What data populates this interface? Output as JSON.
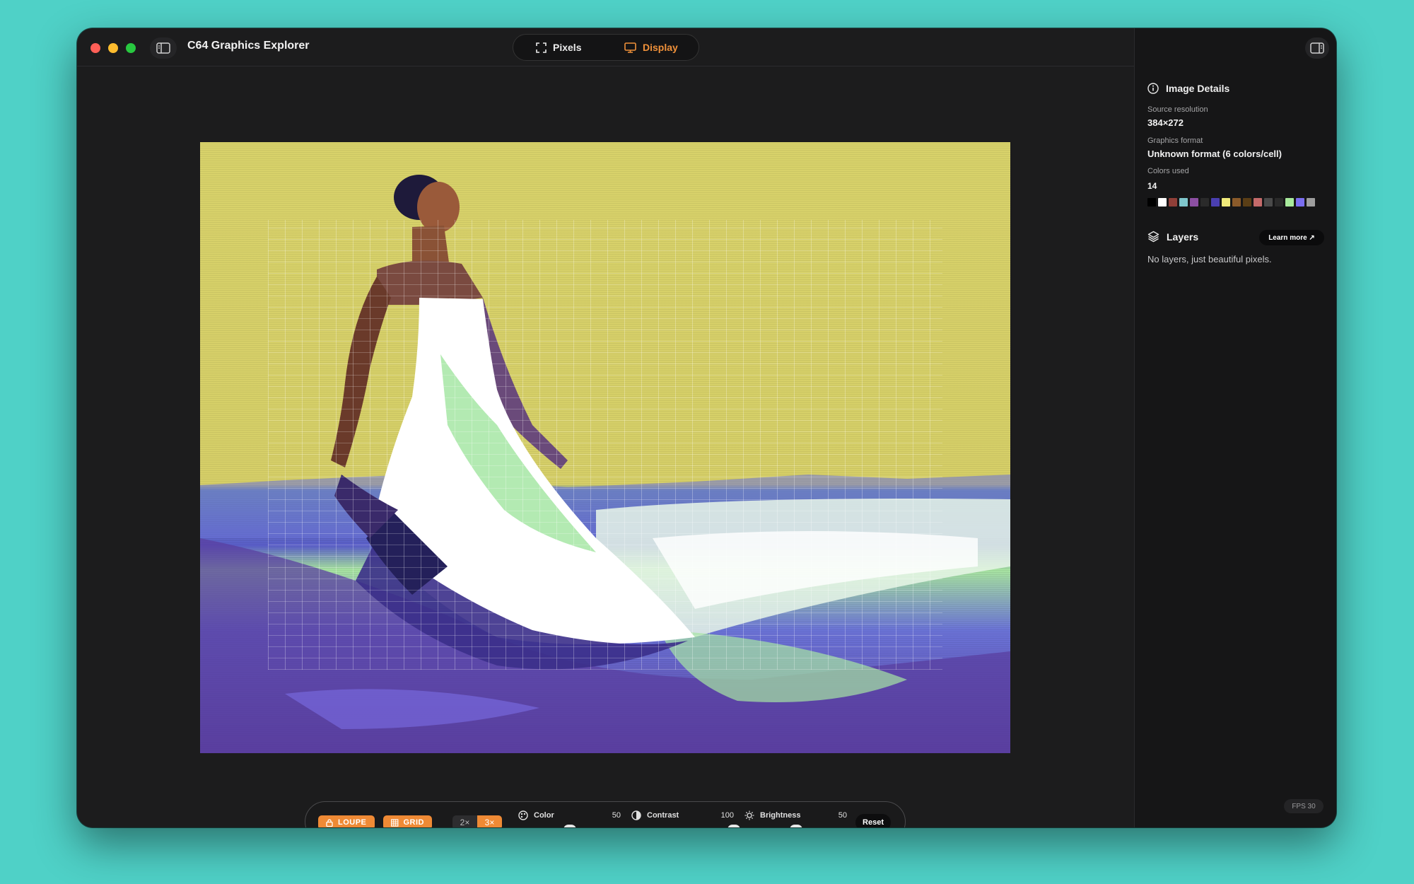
{
  "app": {
    "title": "C64 Graphics Explorer"
  },
  "modes": {
    "pixels": "Pixels",
    "display": "Display",
    "active": "Display"
  },
  "toolbar": {
    "loupe": "LOUPE",
    "grid": "GRID",
    "zoom": [
      "2×",
      "3×"
    ],
    "zoom_selected": "3×",
    "color": {
      "label": "Color",
      "value": "50",
      "level": 0.5
    },
    "contrast": {
      "label": "Contrast",
      "value": "100",
      "level": 1.0
    },
    "brightness": {
      "label": "Brightness",
      "value": "50",
      "level": 0.5
    },
    "reset": "Reset"
  },
  "inspector": {
    "details_title": "Image Details",
    "source_resolution_label": "Source resolution",
    "source_resolution": "384×272",
    "graphics_format_label": "Graphics format",
    "graphics_format": "Unknown format (6 colors/cell)",
    "colors_used_label": "Colors used",
    "colors_used": "14",
    "palette": [
      "#000000",
      "#ffffff",
      "#8f3f38",
      "#7fc6cc",
      "#8c4fa2",
      "#2a2a2a",
      "#4a3fb0",
      "#f0ea7a",
      "#8a5a2a",
      "#5a3e16",
      "#c46a6a",
      "#4a4a4a",
      "#2a2a2a",
      "#a8ea9c",
      "#7a6ef0",
      "#9e9e9e"
    ],
    "layers_title": "Layers",
    "learn_more": "Learn more ↗",
    "layers_text": "No layers, just beautiful pixels."
  },
  "status": {
    "fps": "FPS 30"
  },
  "colors": {
    "accent": "#ef8a35",
    "window_bg": "#1c1c1d",
    "desktop": "#4fd1c7"
  }
}
